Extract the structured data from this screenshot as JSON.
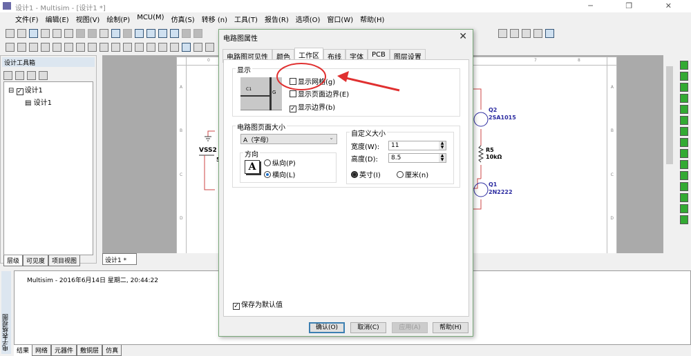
{
  "window": {
    "title": "设计1 - Multisim - [设计1 *]",
    "controls": "─ ❐ ✕"
  },
  "menu": [
    "文件(F)",
    "编辑(E)",
    "视图(V)",
    "绘制(P)",
    "MCU(M)",
    "仿真(S)",
    "转移 (n)",
    "工具(T)",
    "报告(R)",
    "选项(O)",
    "窗口(W)",
    "帮助(H)"
  ],
  "toolbox": {
    "title": "设计工具箱",
    "tree": {
      "root": "设计1",
      "child": "设计1"
    },
    "tabs": [
      "层级",
      "可见度",
      "项目视图"
    ]
  },
  "sheet": {
    "col_labels": [
      "0",
      "7",
      "8"
    ],
    "row_labels": [
      "A",
      "B",
      "C",
      "D"
    ],
    "tab": "设计1 *",
    "components": {
      "vss": "VSS2",
      "vss_val": "5",
      "q2": "Q2",
      "q2_part": "2SA1015",
      "r5": "R5",
      "r5_val": "10kΩ",
      "q1": "Q1",
      "q1_part": "2N2222"
    }
  },
  "log": {
    "side_title": "电子表格视图",
    "message": "Multisim  -  2016年6月14日 星期二, 20:44:22",
    "tabs": [
      "结果",
      "网络",
      "元器件",
      "敷铜层",
      "仿真"
    ]
  },
  "dialog": {
    "title": "电路图属性",
    "close": "✕",
    "tabs": [
      "电路图可见性",
      "颜色",
      "工作区",
      "布线",
      "字体",
      "PCB",
      "图层设置"
    ],
    "active_tab": "工作区",
    "display_group": "显示",
    "preview_labels": {
      "cap": "C1",
      "g": "G"
    },
    "show_grid": {
      "label": "显示网格(g)",
      "checked": false
    },
    "show_page_bounds": {
      "label": "显示页面边界(E)",
      "checked": false
    },
    "show_border": {
      "label": "显示边界(b)",
      "checked": true
    },
    "page_size_group": "电路图页面大小",
    "page_size": "A（字母）",
    "orientation_group": "方向",
    "orientation_icon": "A",
    "portrait": "纵向(P)",
    "landscape": "横向(L)",
    "orientation": "landscape",
    "custom_group": "自定义大小",
    "width_label": "宽度(W):",
    "width": "11",
    "height_label": "高度(D):",
    "height": "8.5",
    "inch": "英寸(I)",
    "cm": "厘米(n)",
    "unit": "inch",
    "save_default": {
      "label": "保存为默认值",
      "checked": true
    },
    "buttons": {
      "ok": "确认(O)",
      "cancel": "取消(C)",
      "apply": "应用(A)",
      "help": "帮助(H)"
    }
  },
  "annotation_color": "#e03030"
}
